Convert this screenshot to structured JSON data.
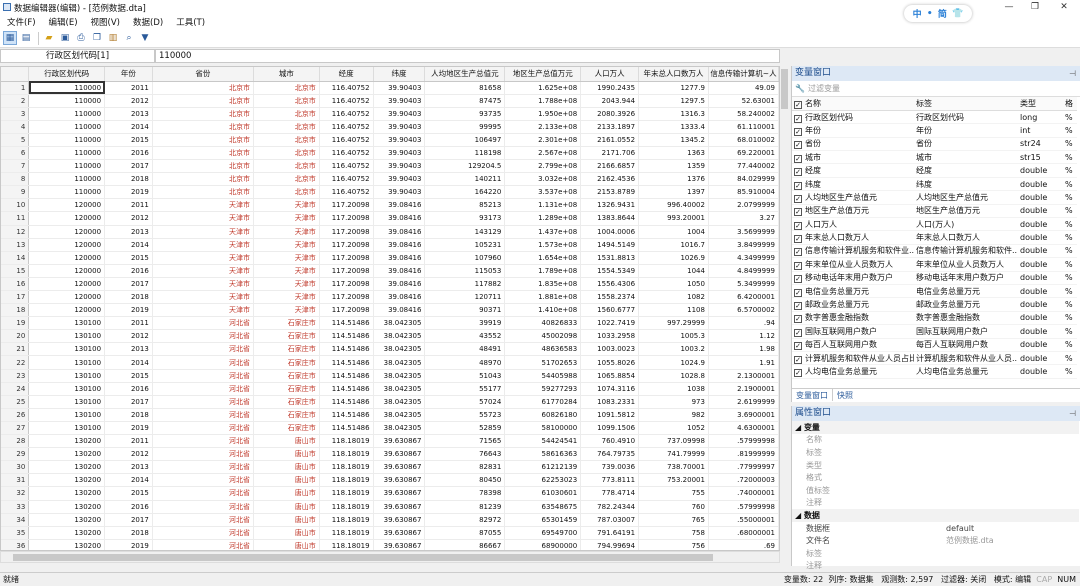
{
  "window": {
    "title": "数据编辑器(编辑) - [范例数据.dta]",
    "min": "—",
    "max": "❐",
    "close": "✕"
  },
  "ime": {
    "mode": "中",
    "style": "简"
  },
  "menu": [
    "文件(F)",
    "编辑(E)",
    "视图(V)",
    "数据(D)",
    "工具(T)"
  ],
  "toolbar": {
    "icons": [
      "grid-edit-icon",
      "grid-browse-icon",
      "open-icon",
      "save-icon",
      "print-icon",
      "copy-icon",
      "paste-icon",
      "search-icon",
      "filter-icon"
    ]
  },
  "address": {
    "cell_ref": "行政区划代码[1]",
    "cell_value": "110000"
  },
  "grid": {
    "columns": [
      "",
      "行政区划代码",
      "年份",
      "省份",
      "城市",
      "经度",
      "纬度",
      "人均地区生产总值元",
      "地区生产总值万元",
      "人口万人",
      "年末总人口数万人",
      "信息传输计算机~人"
    ],
    "rows": [
      [
        "1",
        "110000",
        "2011",
        "北京市",
        "北京市",
        "116.40752",
        "39.90403",
        "81658",
        "1.625e+08",
        "1990.2435",
        "1277.9",
        "49.09"
      ],
      [
        "2",
        "110000",
        "2012",
        "北京市",
        "北京市",
        "116.40752",
        "39.90403",
        "87475",
        "1.788e+08",
        "2043.944",
        "1297.5",
        "52.63001"
      ],
      [
        "3",
        "110000",
        "2013",
        "北京市",
        "北京市",
        "116.40752",
        "39.90403",
        "93735",
        "1.950e+08",
        "2080.3926",
        "1316.3",
        "58.240002"
      ],
      [
        "4",
        "110000",
        "2014",
        "北京市",
        "北京市",
        "116.40752",
        "39.90403",
        "99995",
        "2.133e+08",
        "2133.1897",
        "1333.4",
        "61.110001"
      ],
      [
        "5",
        "110000",
        "2015",
        "北京市",
        "北京市",
        "116.40752",
        "39.90403",
        "106497",
        "2.301e+08",
        "2161.0552",
        "1345.2",
        "68.010002"
      ],
      [
        "6",
        "110000",
        "2016",
        "北京市",
        "北京市",
        "116.40752",
        "39.90403",
        "118198",
        "2.567e+08",
        "2171.706",
        "1363",
        "69.220001"
      ],
      [
        "7",
        "110000",
        "2017",
        "北京市",
        "北京市",
        "116.40752",
        "39.90403",
        "129204.5",
        "2.799e+08",
        "2166.6857",
        "1359",
        "77.440002"
      ],
      [
        "8",
        "110000",
        "2018",
        "北京市",
        "北京市",
        "116.40752",
        "39.90403",
        "140211",
        "3.032e+08",
        "2162.4536",
        "1376",
        "84.029999"
      ],
      [
        "9",
        "110000",
        "2019",
        "北京市",
        "北京市",
        "116.40752",
        "39.90403",
        "164220",
        "3.537e+08",
        "2153.8789",
        "1397",
        "85.910004"
      ],
      [
        "10",
        "120000",
        "2011",
        "天津市",
        "天津市",
        "117.20098",
        "39.08416",
        "85213",
        "1.131e+08",
        "1326.9431",
        "996.40002",
        "2.0799999"
      ],
      [
        "11",
        "120000",
        "2012",
        "天津市",
        "天津市",
        "117.20098",
        "39.08416",
        "93173",
        "1.289e+08",
        "1383.8644",
        "993.20001",
        "3.27"
      ],
      [
        "12",
        "120000",
        "2013",
        "天津市",
        "天津市",
        "117.20098",
        "39.08416",
        "143129",
        "1.437e+08",
        "1004.0006",
        "1004",
        "3.5699999"
      ],
      [
        "13",
        "120000",
        "2014",
        "天津市",
        "天津市",
        "117.20098",
        "39.08416",
        "105231",
        "1.573e+08",
        "1494.5149",
        "1016.7",
        "3.8499999"
      ],
      [
        "14",
        "120000",
        "2015",
        "天津市",
        "天津市",
        "117.20098",
        "39.08416",
        "107960",
        "1.654e+08",
        "1531.8813",
        "1026.9",
        "4.3499999"
      ],
      [
        "15",
        "120000",
        "2016",
        "天津市",
        "天津市",
        "117.20098",
        "39.08416",
        "115053",
        "1.789e+08",
        "1554.5349",
        "1044",
        "4.8499999"
      ],
      [
        "16",
        "120000",
        "2017",
        "天津市",
        "天津市",
        "117.20098",
        "39.08416",
        "117882",
        "1.835e+08",
        "1556.4306",
        "1050",
        "5.3499999"
      ],
      [
        "17",
        "120000",
        "2018",
        "天津市",
        "天津市",
        "117.20098",
        "39.08416",
        "120711",
        "1.881e+08",
        "1558.2374",
        "1082",
        "6.4200001"
      ],
      [
        "18",
        "120000",
        "2019",
        "天津市",
        "天津市",
        "117.20098",
        "39.08416",
        "90371",
        "1.410e+08",
        "1560.6777",
        "1108",
        "6.5700002"
      ],
      [
        "19",
        "130100",
        "2011",
        "河北省",
        "石家庄市",
        "114.51486",
        "38.042305",
        "39919",
        "40826833",
        "1022.7419",
        "997.29999",
        ".94"
      ],
      [
        "20",
        "130100",
        "2012",
        "河北省",
        "石家庄市",
        "114.51486",
        "38.042305",
        "43552",
        "45002098",
        "1033.2958",
        "1005.3",
        "1.12"
      ],
      [
        "21",
        "130100",
        "2013",
        "河北省",
        "石家庄市",
        "114.51486",
        "38.042305",
        "48491",
        "48636583",
        "1003.0023",
        "1003.2",
        "1.98"
      ],
      [
        "22",
        "130100",
        "2014",
        "河北省",
        "石家庄市",
        "114.51486",
        "38.042305",
        "48970",
        "51702653",
        "1055.8026",
        "1024.9",
        "1.91"
      ],
      [
        "23",
        "130100",
        "2015",
        "河北省",
        "石家庄市",
        "114.51486",
        "38.042305",
        "51043",
        "54405988",
        "1065.8854",
        "1028.8",
        "2.1300001"
      ],
      [
        "24",
        "130100",
        "2016",
        "河北省",
        "石家庄市",
        "114.51486",
        "38.042305",
        "55177",
        "59277293",
        "1074.3116",
        "1038",
        "2.1900001"
      ],
      [
        "25",
        "130100",
        "2017",
        "河北省",
        "石家庄市",
        "114.51486",
        "38.042305",
        "57024",
        "61770284",
        "1083.2331",
        "973",
        "2.6199999"
      ],
      [
        "26",
        "130100",
        "2018",
        "河北省",
        "石家庄市",
        "114.51486",
        "38.042305",
        "55723",
        "60826180",
        "1091.5812",
        "982",
        "3.6900001"
      ],
      [
        "27",
        "130100",
        "2019",
        "河北省",
        "石家庄市",
        "114.51486",
        "38.042305",
        "52859",
        "58100000",
        "1099.1506",
        "1052",
        "4.6300001"
      ],
      [
        "28",
        "130200",
        "2011",
        "河北省",
        "唐山市",
        "118.18019",
        "39.630867",
        "71565",
        "54424541",
        "760.4910",
        "737.09998",
        ".57999998"
      ],
      [
        "29",
        "130200",
        "2012",
        "河北省",
        "唐山市",
        "118.18019",
        "39.630867",
        "76643",
        "58616363",
        "764.79735",
        "741.79999",
        ".81999999"
      ],
      [
        "30",
        "130200",
        "2013",
        "河北省",
        "唐山市",
        "118.18019",
        "39.630867",
        "82831",
        "61212139",
        "739.0036",
        "738.70001",
        ".77999997"
      ],
      [
        "31",
        "130200",
        "2014",
        "河北省",
        "唐山市",
        "118.18019",
        "39.630867",
        "80450",
        "62253023",
        "773.8111",
        "753.20001",
        ".72000003"
      ],
      [
        "32",
        "130200",
        "2015",
        "河北省",
        "唐山市",
        "118.18019",
        "39.630867",
        "78398",
        "61030601",
        "778.4714",
        "755",
        ".74000001"
      ],
      [
        "33",
        "130200",
        "2016",
        "河北省",
        "唐山市",
        "118.18019",
        "39.630867",
        "81239",
        "63548675",
        "782.24344",
        "760",
        ".57999998"
      ],
      [
        "34",
        "130200",
        "2017",
        "河北省",
        "唐山市",
        "118.18019",
        "39.630867",
        "82972",
        "65301459",
        "787.03007",
        "765",
        ".55000001"
      ],
      [
        "35",
        "130200",
        "2018",
        "河北省",
        "唐山市",
        "118.18019",
        "39.630867",
        "87055",
        "69549700",
        "791.64191",
        "758",
        ".68000001"
      ],
      [
        "36",
        "130200",
        "2019",
        "河北省",
        "唐山市",
        "118.18019",
        "39.630867",
        "86667",
        "68900000",
        "794.99694",
        "756",
        ".69"
      ]
    ]
  },
  "var_panel": {
    "title": "变量窗口",
    "filter_placeholder": "过滤变量",
    "headers": [
      "名称",
      "标签",
      "类型",
      "格"
    ],
    "vars": [
      [
        "行政区划代码",
        "行政区划代码",
        "long",
        "%"
      ],
      [
        "年份",
        "年份",
        "int",
        "%"
      ],
      [
        "省份",
        "省份",
        "str24",
        "%"
      ],
      [
        "城市",
        "城市",
        "str15",
        "%"
      ],
      [
        "经度",
        "经度",
        "double",
        "%"
      ],
      [
        "纬度",
        "纬度",
        "double",
        "%"
      ],
      [
        "人均地区生产总值元",
        "人均地区生产总值元",
        "double",
        "%"
      ],
      [
        "地区生产总值万元",
        "地区生产总值万元",
        "double",
        "%"
      ],
      [
        "人口万人",
        "人口(万人)",
        "double",
        "%"
      ],
      [
        "年末总人口数万人",
        "年末总人口数万人",
        "double",
        "%"
      ],
      [
        "信息传输计算机服务和软件业...",
        "信息传输计算机服务和软件...",
        "double",
        "%"
      ],
      [
        "年末单位从业人员数万人",
        "年末单位从业人员数万人",
        "double",
        "%"
      ],
      [
        "移动电话年末用户数万户",
        "移动电话年末用户数万户",
        "double",
        "%"
      ],
      [
        "电信业务总量万元",
        "电信业务总量万元",
        "double",
        "%"
      ],
      [
        "邮政业务总量万元",
        "邮政业务总量万元",
        "double",
        "%"
      ],
      [
        "数字普惠金融指数",
        "数字普惠金融指数",
        "double",
        "%"
      ],
      [
        "国际互联网用户数户",
        "国际互联网用户数户",
        "double",
        "%"
      ],
      [
        "每百人互联网用户数",
        "每百人互联网用户数",
        "double",
        "%"
      ],
      [
        "计算机服务和软件从业人员占比",
        "计算机服务和软件从业人员...",
        "double",
        "%"
      ],
      [
        "人均电信业务总量元",
        "人均电信业务总量元",
        "double",
        "%"
      ]
    ],
    "tabs": [
      "变量窗口",
      "快照"
    ]
  },
  "prop_panel": {
    "title": "属性窗口",
    "sections": [
      {
        "name": "变量",
        "rows": [
          [
            "名称",
            ""
          ],
          [
            "标签",
            ""
          ],
          [
            "类型",
            ""
          ],
          [
            "格式",
            ""
          ],
          [
            "值标签",
            ""
          ],
          [
            "注释",
            ""
          ]
        ]
      },
      {
        "name": "数据",
        "rows": [
          [
            "数据框",
            "default"
          ],
          [
            "文件名",
            "范例数据.dta"
          ],
          [
            "标签",
            ""
          ],
          [
            "注释",
            ""
          ]
        ]
      }
    ]
  },
  "status": {
    "left": "就绪",
    "vars": "变量数: 22",
    "order": "列序: 数据集",
    "obs": "观测数: 2,597",
    "filter": "过滤器: 关闭",
    "mode": "模式: 编辑",
    "cap": "CAP",
    "num": "NUM"
  }
}
